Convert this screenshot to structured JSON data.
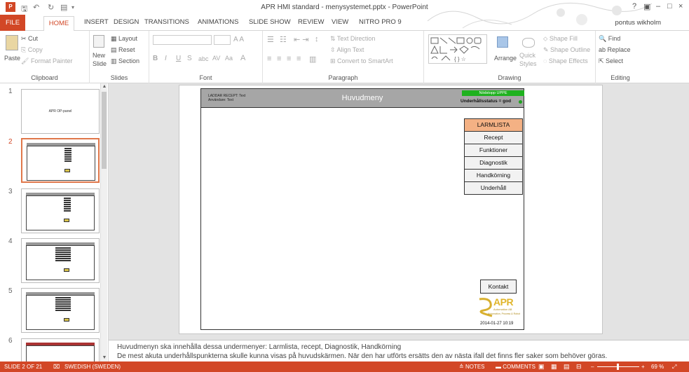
{
  "window": {
    "title": "APR HMI standard - menysystemet.pptx - PowerPoint",
    "user": "pontus wikholm",
    "help": "?",
    "controls": [
      "–",
      "□",
      "×"
    ]
  },
  "tabs": [
    "FILE",
    "HOME",
    "INSERT",
    "DESIGN",
    "TRANSITIONS",
    "ANIMATIONS",
    "SLIDE SHOW",
    "REVIEW",
    "VIEW",
    "NITRO PRO 9"
  ],
  "ribbon": {
    "clipboard": {
      "name": "Clipboard",
      "paste": "Paste",
      "cut": "Cut",
      "copy": "Copy",
      "format_painter": "Format Painter"
    },
    "slides": {
      "name": "Slides",
      "new_slide_1": "New",
      "new_slide_2": "Slide",
      "layout": "Layout",
      "reset": "Reset",
      "section": "Section"
    },
    "font": {
      "name": "Font"
    },
    "paragraph": {
      "name": "Paragraph",
      "text_direction": "Text Direction",
      "align_text": "Align Text",
      "convert": "Convert to SmartArt"
    },
    "drawing": {
      "name": "Drawing",
      "arrange": "Arrange",
      "quick_styles_1": "Quick",
      "quick_styles_2": "Styles",
      "shape_fill": "Shape Fill",
      "shape_outline": "Shape Outline",
      "shape_effects": "Shape Effects"
    },
    "editing": {
      "name": "Editing",
      "find": "Find",
      "replace": "Replace",
      "select": "Select"
    }
  },
  "thumbnails": {
    "numbers": [
      "1",
      "2",
      "3",
      "4",
      "5",
      "6"
    ],
    "slide1_text": "APR OP-panel"
  },
  "slide": {
    "recept_line": "LADDAR RECEPT: Text",
    "user_line": "Användare: Text",
    "title": "Huvudmeny",
    "nodstopp": "Nödstopp UPPE",
    "status": "Underhållsstatus = god",
    "menu": [
      "LARMLISTA",
      "Recept",
      "Funktioner",
      "Diagnostik",
      "Handkörning",
      "Underhåll"
    ],
    "kontakt": "Kontakt",
    "logo": "APR",
    "logo_sub": "Automation AB",
    "logo_sub2": "Automation, Process & Robot",
    "datetime": "2014-01-27   10:19"
  },
  "notes": [
    "Huvudmenyn ska innehålla dessa undermenyer: Larmlista, recept, Diagnostik, Handkörning",
    "De mest akuta underhållspunkterna skulle kunna visas på huvudskärmen. När den har utförts ersätts den av nästa ifall det finns fler saker som behöver göras."
  ],
  "statusbar": {
    "slide": "SLIDE 2 OF 21",
    "language": "SWEDISH (SWEDEN)",
    "notes": "NOTES",
    "comments": "COMMENTS",
    "zoom": "69 %"
  },
  "colors": {
    "accent": "#d24726",
    "highlight": "#f4b184",
    "nodstopp": "#1fb21f"
  }
}
